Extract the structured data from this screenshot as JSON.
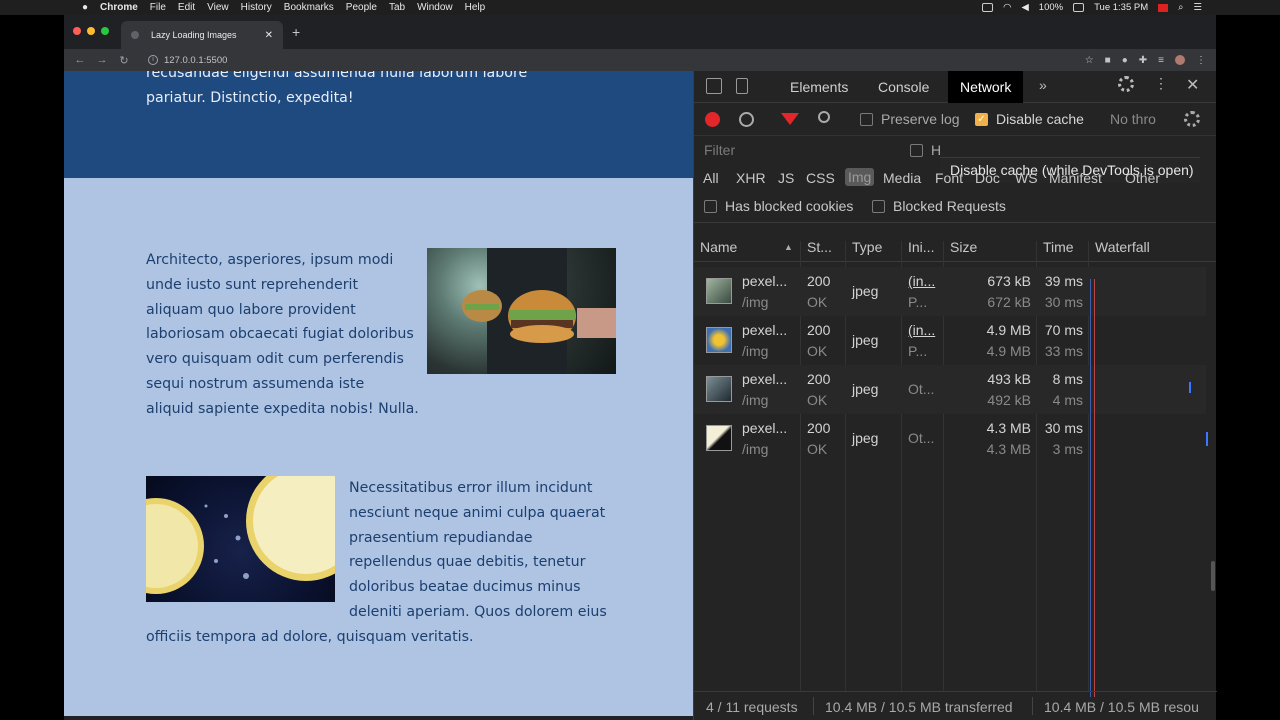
{
  "menubar": {
    "app": "Chrome",
    "items": [
      "File",
      "Edit",
      "View",
      "History",
      "Bookmarks",
      "People",
      "Tab",
      "Window",
      "Help"
    ],
    "battery": "100%",
    "clock": "Tue 1:35 PM"
  },
  "browser": {
    "tab_title": "Lazy Loading Images",
    "url": "127.0.0.1:5500"
  },
  "page": {
    "hero_text": "recusandae eligendi assumenda nulla laborum labore pariatur. Distinctio, expedita!",
    "para1": "Architecto, asperiores, ipsum modi unde iusto sunt reprehenderit aliquam quo labore provident laboriosam obcaecati fugiat doloribus vero quisquam odit cum perferendis sequi nostrum assumenda iste aliquid sapiente expedita nobis! Nulla.",
    "para2": "Necessitatibus error illum incidunt nesciunt neque animi culpa quaerat praesentium repudiandae repellendus quae debitis, tenetur doloribus beatae ducimus minus deleniti aperiam. Quos dolorem eius officiis tempora ad dolore, quisquam veritatis."
  },
  "devtools": {
    "tabs": [
      "Elements",
      "Console",
      "Network"
    ],
    "active_tab": "Network",
    "more": "»",
    "toolbar": {
      "preserve_log": "Preserve log",
      "disable_cache": "Disable cache",
      "throttle": "No thro"
    },
    "tooltip": "Disable cache (while DevTools is open)",
    "filter_placeholder": "Filter",
    "hide_label": "H",
    "types": [
      "All",
      "XHR",
      "JS",
      "CSS",
      "Img",
      "Media",
      "Font",
      "Doc",
      "WS",
      "Manifest",
      "Other"
    ],
    "selected_type": "Img",
    "has_blocked_cookies": "Has blocked cookies",
    "blocked_requests": "Blocked Requests",
    "columns": [
      "Name",
      "St...",
      "Type",
      "Ini...",
      "Size",
      "Time",
      "Waterfall"
    ],
    "rows": [
      {
        "name": "pexel...",
        "path": "/img",
        "status": "200",
        "status_text": "OK",
        "type": "jpeg",
        "initiator": "(in...",
        "initiator2": "P...",
        "size": "673 kB",
        "size2": "672 kB",
        "time": "39 ms",
        "time2": "30 ms"
      },
      {
        "name": "pexel...",
        "path": "/img",
        "status": "200",
        "status_text": "OK",
        "type": "jpeg",
        "initiator": "(in...",
        "initiator2": "P...",
        "size": "4.9 MB",
        "size2": "4.9 MB",
        "time": "70 ms",
        "time2": "33 ms"
      },
      {
        "name": "pexel...",
        "path": "/img",
        "status": "200",
        "status_text": "OK",
        "type": "jpeg",
        "initiator": "Ot...",
        "initiator2": "",
        "size": "493 kB",
        "size2": "492 kB",
        "time": "8 ms",
        "time2": "4 ms"
      },
      {
        "name": "pexel...",
        "path": "/img",
        "status": "200",
        "status_text": "OK",
        "type": "jpeg",
        "initiator": "Ot...",
        "initiator2": "",
        "size": "4.3 MB",
        "size2": "4.3 MB",
        "time": "30 ms",
        "time2": "3 ms"
      }
    ],
    "status": {
      "requests": "4 / 11 requests",
      "transferred": "10.4 MB / 10.5 MB transferred",
      "resources": "10.4 MB / 10.5 MB resou"
    }
  },
  "colors": {
    "hero_bg": "#1f4a80",
    "page_bg": "#aec4e2",
    "record": "#e3262a",
    "checkbox_checked": "#f0b04a"
  }
}
